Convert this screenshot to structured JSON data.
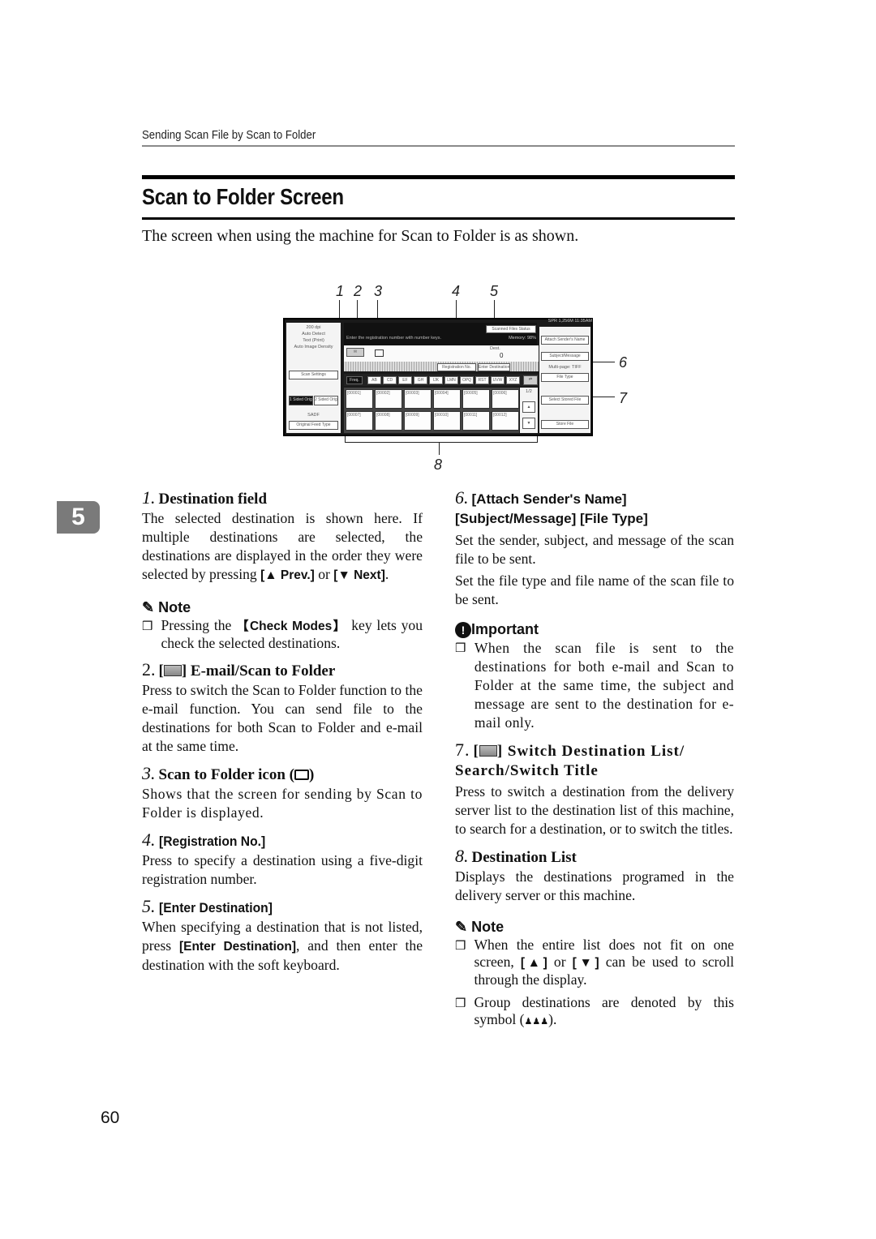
{
  "header": {
    "running_head": "Sending Scan File by Scan to Folder",
    "title": "Scan to Folder Screen",
    "intro": "The screen when using the machine for Scan to Folder is as shown."
  },
  "figure": {
    "callouts": [
      "1",
      "2",
      "3",
      "4",
      "5",
      "6",
      "7",
      "8"
    ],
    "screen": {
      "status_bar": "SPR   1,256M  11:35AM",
      "left_panel": [
        "200 dpi",
        "Auto Detect",
        "Text (Print)",
        "Auto Image Density"
      ],
      "scan_settings_button": "Scan Settings",
      "sided_buttons": [
        "1 Sided Orig.",
        "2 Sided Orig."
      ],
      "size_label": "SADF",
      "orig_feed_button": "Original Feed Type",
      "message": "Enter the registration number with number keys.",
      "scanned_files_button": "Scanned Files Status",
      "memory": "Memory: 98%",
      "dest_label": "Dest.",
      "dest_count": "0",
      "registration_button": "Registration No.",
      "enter_dest_button": "Enter Destination",
      "index_tabs": [
        "Freq.",
        "AB",
        "CD",
        "EF",
        "GH",
        "IJK",
        "LMN",
        "OPQ",
        "RST",
        "UVW",
        "XYZ"
      ],
      "destinations": [
        [
          "[00001]",
          "[00002]",
          "[00003]",
          "[00004]",
          "[00005]",
          "[00006]"
        ],
        [
          "[00007]",
          "[00008]",
          "[00009]",
          "[00010]",
          "[00011]",
          "[00012]"
        ]
      ],
      "page_indicator": "1/2",
      "right_buttons": [
        "Attach Sender's Name",
        "Subject/Message",
        "File Type",
        "Select Stored File",
        "Store File"
      ],
      "file_type_value": "Multi-page: TIFF"
    }
  },
  "chapter_tab": "5",
  "left_column": {
    "item1": {
      "num": "1.",
      "title": "Destination field",
      "body_a": "The selected destination is shown here. If multiple destinations are selected, the destinations are displayed in the order they were selected by pressing ",
      "key_prev": "[▲ Prev.]",
      "or": " or ",
      "key_next": "[▼ Next]",
      "end": "."
    },
    "note1": {
      "heading": "Note",
      "pre": "Pressing the ",
      "key": "【Check Modes】",
      "post": " key lets you check the selected destinations."
    },
    "item2": {
      "num": "2.",
      "title": "E-mail/Scan to Folder",
      "body": "Press to switch the Scan to Folder function to the e-mail function. You can send file to the destinations for both Scan to Folder and e-mail at the same time."
    },
    "item3": {
      "num": "3.",
      "title": "Scan to Folder icon (",
      "title_end": ")",
      "body": "Shows that the screen for sending by Scan to Folder is displayed."
    },
    "item4": {
      "num": "4.",
      "title": "[Registration No.]",
      "body": "Press to specify a destination using a five-digit registration number."
    },
    "item5": {
      "num": "5.",
      "title": "[Enter Destination]",
      "pre": "When specifying a destination that is not listed, press ",
      "key": "[Enter Destination]",
      "post": ", and then enter the destination with the soft keyboard."
    }
  },
  "right_column": {
    "item6": {
      "num": "6.",
      "title": "[Attach Sender's Name] [Subject/Message] [File Type]",
      "body1": "Set the sender, subject, and message of the scan file to be sent.",
      "body2": "Set the file type and file name of the scan file to be sent."
    },
    "important": {
      "heading": "Important",
      "text": "When the scan file is sent to the destinations for both e-mail and Scan to Folder at the same time, the subject and message are sent to the destination for e-mail only."
    },
    "item7": {
      "num": "7.",
      "title": "Switch Destination List/ Search/Switch Title",
      "body": "Press to switch a destination from the delivery server list to the destination list of this machine, to search for a destination, or to switch the titles."
    },
    "item8": {
      "num": "8.",
      "title": "Destination List",
      "body": "Displays the destinations programed in the delivery server or this machine."
    },
    "note2": {
      "heading": "Note",
      "b1_pre": "When the entire list does not fit on one screen, ",
      "b1_up": "[▲]",
      "b1_or": " or ",
      "b1_down": "[▼]",
      "b1_post": " can be used to scroll through the display.",
      "b2_pre": "Group destinations are denoted by this symbol (",
      "b2_post": ")."
    }
  },
  "footer": {
    "page_number": "60"
  }
}
